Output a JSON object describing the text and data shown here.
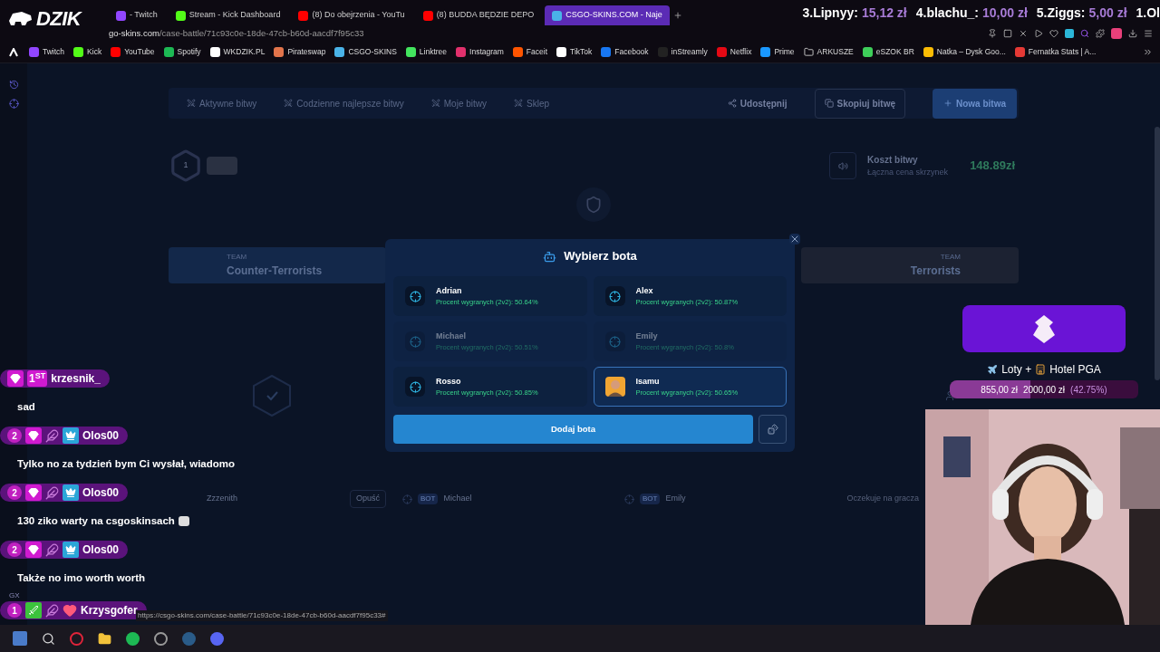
{
  "logo": {
    "text": "DZIK"
  },
  "tabs": [
    {
      "label": "- Twitch",
      "kind": "twitch",
      "selected": false
    },
    {
      "label": "Stream - Kick Dashboard",
      "kind": "kick",
      "selected": false
    },
    {
      "label": "(8) Do obejrzenia - YouTu",
      "kind": "youtube",
      "selected": false
    },
    {
      "label": "(8) BUDDA BĘDZIE DEPO",
      "kind": "youtube",
      "selected": false
    },
    {
      "label": "CSGO-SKINS.COM - Naje",
      "kind": "csgo",
      "selected": true
    }
  ],
  "address": {
    "host": "go-skins.com",
    "path": "/case-battle/71c93c0e-18de-47cb-b60d-aacdf7f95c33"
  },
  "ticker": [
    {
      "rank": "3.Lipnyy:",
      "amount": "15,12 zł"
    },
    {
      "rank": "4.blachu_:",
      "amount": "10,00 zł"
    },
    {
      "rank": "5.Ziggs:",
      "amount": "5,00 zł"
    },
    {
      "rank": "1.Ol"
    }
  ],
  "bookmarks": [
    {
      "label": "Twitch",
      "kind": "twitch"
    },
    {
      "label": "Kick",
      "kind": "kick"
    },
    {
      "label": "YouTube",
      "kind": "youtube"
    },
    {
      "label": "Spotify",
      "kind": "spotify"
    },
    {
      "label": "WKDZIK.PL",
      "kind": "boar"
    },
    {
      "label": "Pirateswap",
      "kind": "pirate"
    },
    {
      "label": "CSGO-SKINS",
      "kind": "csgo"
    },
    {
      "label": "Linktree",
      "kind": "linktree"
    },
    {
      "label": "Instagram",
      "kind": "instagram"
    },
    {
      "label": "Faceit",
      "kind": "faceit"
    },
    {
      "label": "TikTok",
      "kind": "tiktok"
    },
    {
      "label": "Facebook",
      "kind": "facebook"
    },
    {
      "label": "inStreamly",
      "kind": "instreamly"
    },
    {
      "label": "Netflix",
      "kind": "netflix"
    },
    {
      "label": "Prime",
      "kind": "prime"
    },
    {
      "label": "ARKUSZE",
      "kind": "folder"
    },
    {
      "label": "eSZOK BR",
      "kind": "eszok"
    },
    {
      "label": "Natka – Dysk Goo...",
      "kind": "drive"
    },
    {
      "label": "Fernatka Stats | A...",
      "kind": "stats"
    }
  ],
  "battle_nav": {
    "items": [
      {
        "label": "Aktywne bitwy"
      },
      {
        "label": "Codzienne najlepsze bitwy"
      },
      {
        "label": "Moje bitwy"
      },
      {
        "label": "Sklep"
      }
    ],
    "share": "Udostępnij",
    "copy": "Skopiuj bitwę",
    "new": "Nowa bitwa"
  },
  "round": {
    "number": "1"
  },
  "cost": {
    "title": "Koszt bitwy",
    "subtitle": "Łączna cena skrzynek",
    "value": "148.89zł"
  },
  "teams": [
    {
      "kind": "ct",
      "label": "TEAM",
      "name": "Counter-Terrorists"
    },
    {
      "kind": "t",
      "label": "TEAM",
      "name": "Terrorists"
    }
  ],
  "players": [
    {
      "kind": "player",
      "name": "Zzzenith",
      "action": "Opuść"
    },
    {
      "kind": "bot",
      "badge": "BOT",
      "name": "Michael"
    },
    {
      "kind": "bot",
      "badge": "BOT",
      "name": "Emily"
    },
    {
      "kind": "waiting",
      "name": "Oczekuje na gracza"
    }
  ],
  "modal": {
    "title": "Wybierz bota",
    "bots": [
      {
        "name": "Adrian",
        "winrate": "Procent wygranych (2v2): 50.64%",
        "kind": "target",
        "disabled": false,
        "selected": false
      },
      {
        "name": "Alex",
        "winrate": "Procent wygranych (2v2): 50.87%",
        "kind": "target",
        "disabled": false,
        "selected": false
      },
      {
        "name": "Michael",
        "winrate": "Procent wygranych (2v2): 50.51%",
        "kind": "target",
        "disabled": true,
        "selected": false
      },
      {
        "name": "Emily",
        "winrate": "Procent wygranych (2v2): 50.8%",
        "kind": "target",
        "disabled": true,
        "selected": false
      },
      {
        "name": "Rosso",
        "winrate": "Procent wygranych (2v2): 50.85%",
        "kind": "target",
        "disabled": false,
        "selected": false
      },
      {
        "name": "Isamu",
        "winrate": "Procent wygranych (2v2): 50.65%",
        "kind": "avatar",
        "disabled": false,
        "selected": true
      }
    ],
    "button": "Dodaj bota"
  },
  "chat": [
    {
      "badges": [
        {
          "kind": "gem"
        },
        {
          "kind": "rank",
          "text": "1$^{ST}$"
        }
      ],
      "user": "krzesnik_",
      "message": "sad",
      "emote": false
    },
    {
      "badges": [
        {
          "kind": "count",
          "text": "2"
        },
        {
          "kind": "gem"
        },
        {
          "kind": "wing"
        },
        {
          "kind": "crown"
        }
      ],
      "user": "Olos00",
      "message": "Tylko no za tydzień bym Ci wysłał, wiadomo",
      "emote": false
    },
    {
      "badges": [
        {
          "kind": "count",
          "text": "2"
        },
        {
          "kind": "gem"
        },
        {
          "kind": "wing"
        },
        {
          "kind": "crown"
        }
      ],
      "user": "Olos00",
      "message": "130 ziko warty na csgoskinsach",
      "emote": true
    },
    {
      "badges": [
        {
          "kind": "count",
          "text": "2"
        },
        {
          "kind": "gem"
        },
        {
          "kind": "wing"
        },
        {
          "kind": "crown"
        }
      ],
      "user": "Olos00",
      "message": "Także no imo worth worth",
      "emote": false
    },
    {
      "note": "GX",
      "badges": [
        {
          "kind": "count",
          "text": "1"
        },
        {
          "kind": "sword"
        },
        {
          "kind": "wing"
        },
        {
          "kind": "heart"
        }
      ],
      "user": "Krzysgofer",
      "emote": false
    }
  ],
  "goal": {
    "title": "Loty +",
    "title2": "Hotel PGA",
    "current": "855,00 zł",
    "target": "2000,00 zł",
    "percent": "(42.75%)",
    "level": 0.4275
  },
  "status_url": "https://csgo-skins.com/case-battle/71c93c0e-18de-47cb-b60d-aacdf7f95c33#"
}
